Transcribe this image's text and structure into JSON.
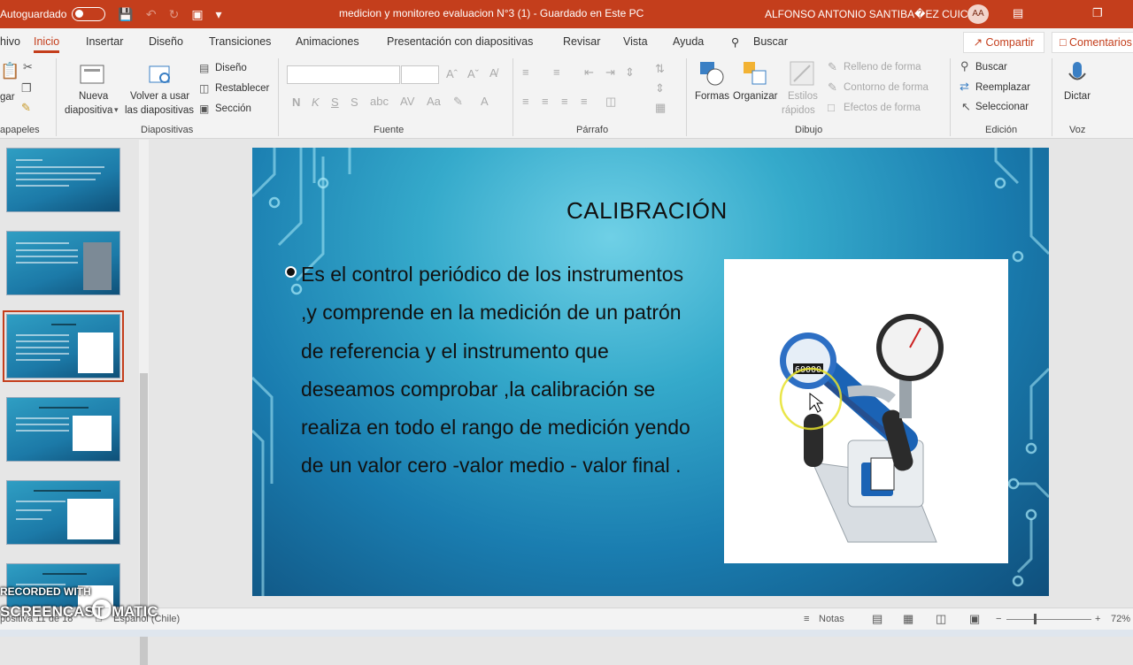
{
  "titlebar": {
    "autosave_label": "Autoguardado",
    "document_title": "medicion y monitoreo evaluacion N°3 (1)  -  Guardado en Este PC",
    "user_name": "ALFONSO ANTONIO SANTIBA�EZ CUICUI",
    "user_initials": "AA",
    "icons": [
      "save-icon",
      "undo-icon",
      "redo-icon",
      "present-icon",
      "customize-icon",
      "ribbon-options-icon",
      "restore-icon"
    ]
  },
  "tabs": [
    {
      "label": "hivo"
    },
    {
      "label": "Inicio",
      "active": true
    },
    {
      "label": "Insertar"
    },
    {
      "label": "Diseño"
    },
    {
      "label": "Transiciones"
    },
    {
      "label": "Animaciones"
    },
    {
      "label": "Presentación con diapositivas"
    },
    {
      "label": "Revisar"
    },
    {
      "label": "Vista"
    },
    {
      "label": "Ayuda"
    },
    {
      "label": "Buscar"
    }
  ],
  "share_label": "Compartir",
  "comments_label": "Comentarios",
  "ribbon": {
    "clipboard": {
      "paste_label": "gar",
      "group_label": "apapeles"
    },
    "slides": {
      "new_slide_1": "Nueva",
      "new_slide_2": "diapositiva",
      "reuse_1": "Volver a usar",
      "reuse_2": "las diapositivas",
      "layout": "Diseño",
      "reset": "Restablecer",
      "section": "Sección",
      "group_label": "Diapositivas"
    },
    "font": {
      "font_name": "",
      "font_size": "",
      "group_label": "Fuente",
      "format_glyphs": [
        "N",
        "K",
        "S",
        "S"
      ]
    },
    "paragraph": {
      "group_label": "Párrafo"
    },
    "drawing": {
      "shapes": "Formas",
      "arrange": "Organizar",
      "styles_1": "Estilos",
      "styles_2": "rápidos",
      "fill": "Relleno de forma",
      "outline": "Contorno de forma",
      "effects": "Efectos de forma",
      "group_label": "Dibujo"
    },
    "editing": {
      "find": "Buscar",
      "replace": "Reemplazar",
      "select": "Seleccionar",
      "group_label": "Edición"
    },
    "voice": {
      "dictate": "Dictar",
      "group_label": "Voz"
    }
  },
  "thumbnails": [
    {
      "index": 1,
      "has_picture": false
    },
    {
      "index": 2,
      "has_picture": true
    },
    {
      "index": 3,
      "has_picture": true,
      "active": true
    },
    {
      "index": 4,
      "has_picture": true
    },
    {
      "index": 5,
      "has_picture": true
    },
    {
      "index": 6,
      "has_picture": true
    }
  ],
  "slide": {
    "title": "CALIBRACIÓN",
    "body": "Es el  control periódico de los instrumentos ,y comprende en la medición de un patrón de referencia y el instrumento que deseamos comprobar ,la calibración se realiza en todo el rango de medición yendo de un valor cero -valor medio - valor final .",
    "image_alt": "pressure calibration pump with digital and analog gauges",
    "gauge_digits": "60000"
  },
  "statusbar": {
    "slide_indicator": "positiva 11 de 18",
    "language": "Español (Chile)",
    "notes_label": "Notas",
    "zoom_label": "72%"
  },
  "watermark": {
    "line1": "RECORDED WITH",
    "line2": "SCREENCAST",
    "line3": "MATIC"
  },
  "colors": {
    "accent": "#c43e1c",
    "slide_bg": "#1a7db0"
  }
}
